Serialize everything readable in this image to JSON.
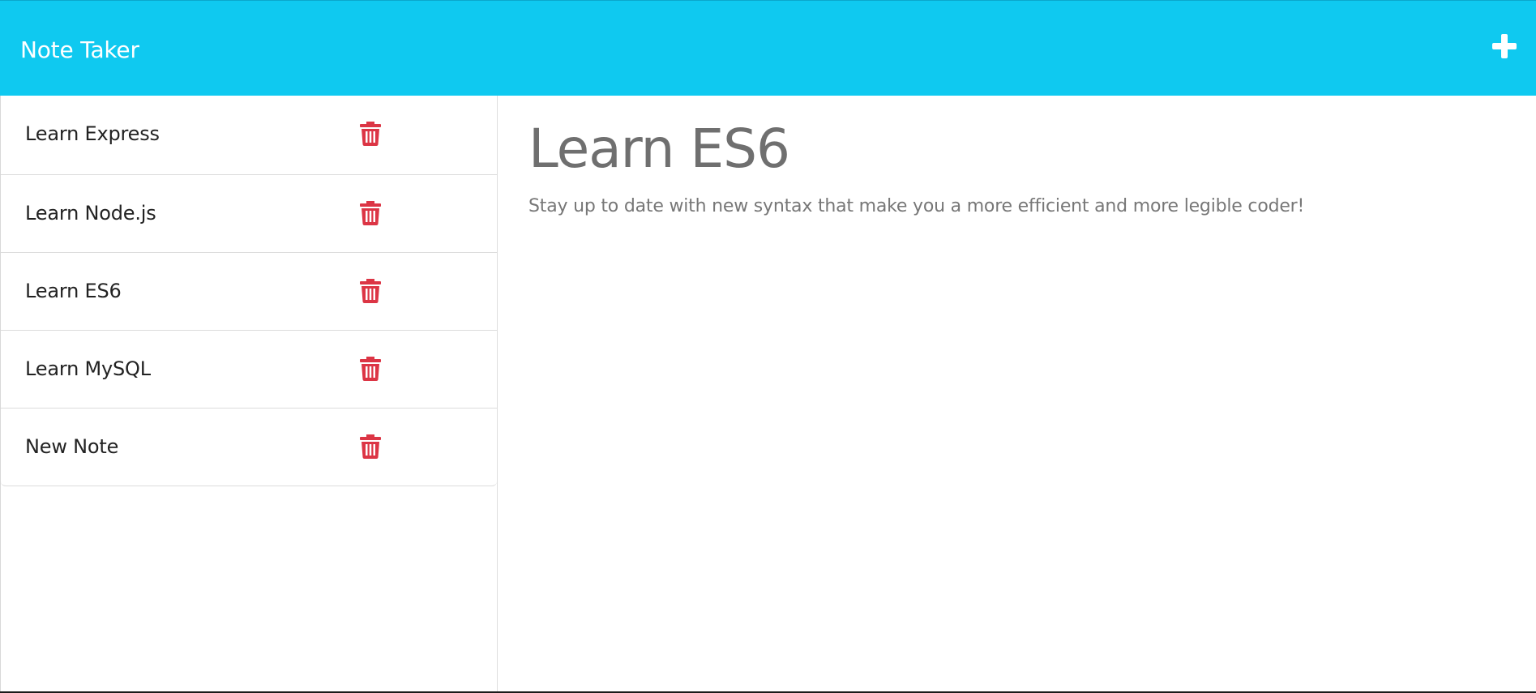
{
  "navbar": {
    "title": "Note Taker",
    "new_note_icon": "plus-icon",
    "background": "#0fc9f0"
  },
  "sidebar": {
    "delete_icon": "trash-icon",
    "delete_color": "#dc3545",
    "notes": [
      {
        "title": "Learn Express"
      },
      {
        "title": "Learn Node.js"
      },
      {
        "title": "Learn ES6"
      },
      {
        "title": "Learn MySQL"
      },
      {
        "title": "New Note"
      }
    ]
  },
  "editor": {
    "title": "Learn ES6",
    "text": "Stay up to date with new syntax that make you a more efficient and more legible coder!"
  }
}
